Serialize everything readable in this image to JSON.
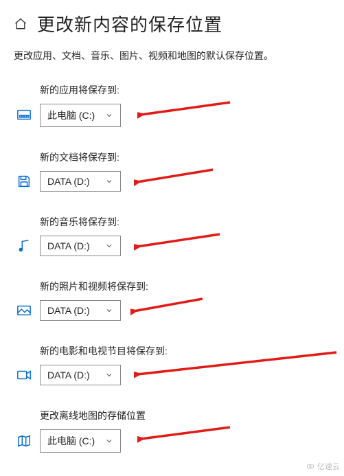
{
  "header": {
    "title": "更改新内容的保存位置",
    "subtitle": "更改应用、文档、音乐、图片、视频和地图的默认保存位置。"
  },
  "options": {
    "this_pc_c": "此电脑 (C:)",
    "data_d": "DATA (D:)"
  },
  "settings": [
    {
      "key": "apps",
      "label": "新的应用将保存到:",
      "icon": "apps",
      "selected": "此电脑 (C:)"
    },
    {
      "key": "docs",
      "label": "新的文档将保存到:",
      "icon": "save",
      "selected": "DATA (D:)"
    },
    {
      "key": "music",
      "label": "新的音乐将保存到:",
      "icon": "music",
      "selected": "DATA (D:)"
    },
    {
      "key": "photos",
      "label": "新的照片和视频将保存到:",
      "icon": "image",
      "selected": "DATA (D:)"
    },
    {
      "key": "movies",
      "label": "新的电影和电视节目将保存到:",
      "icon": "video",
      "selected": "DATA (D:)"
    },
    {
      "key": "maps",
      "label": "更改离线地图的存储位置",
      "icon": "map",
      "selected": "此电脑 (C:)"
    }
  ],
  "watermark": "亿速云",
  "annotation": {
    "arrows_color": "#e11b18"
  }
}
